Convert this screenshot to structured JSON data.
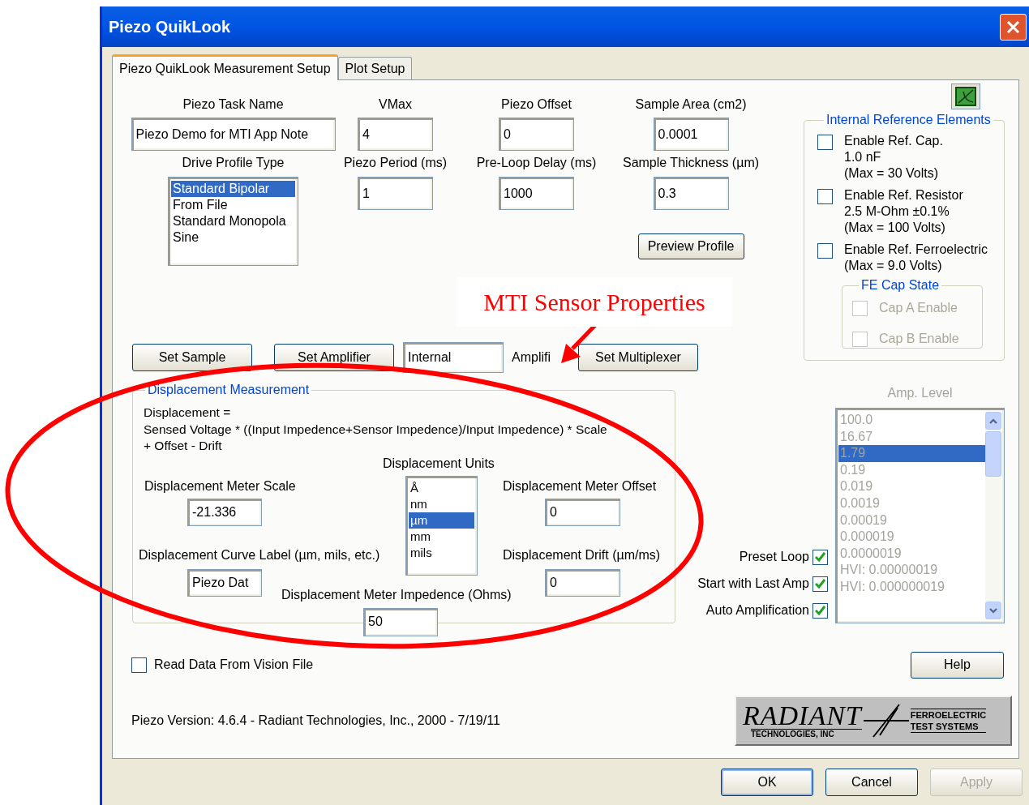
{
  "window": {
    "title": "Piezo QuikLook"
  },
  "tabs": [
    {
      "label": "Piezo QuikLook Measurement Setup",
      "selected": true
    },
    {
      "label": "Plot Setup",
      "selected": false
    }
  ],
  "task_name": {
    "label": "Piezo Task Name",
    "value": "Piezo Demo for MTI App Note"
  },
  "drive_profile": {
    "label": "Drive Profile Type",
    "options": [
      {
        "label": "Standard Bipolar",
        "selected": true
      },
      {
        "label": "From File",
        "selected": false
      },
      {
        "label": "Standard Monopola",
        "selected": false
      },
      {
        "label": "Sine",
        "selected": false
      }
    ]
  },
  "parameter_columns": [
    {
      "top": {
        "label": "VMax",
        "value": "4"
      },
      "bottom": {
        "label": "Piezo Period (ms)",
        "value": "1"
      }
    },
    {
      "top": {
        "label": "Piezo Offset",
        "value": "0"
      },
      "bottom": {
        "label": "Pre-Loop Delay (ms)",
        "value": "1000"
      }
    },
    {
      "top": {
        "label": "Sample Area (cm2)",
        "value": "0.0001"
      },
      "bottom": {
        "label": "Sample Thickness (µm)",
        "value": "0.3"
      }
    }
  ],
  "preview_button": "Preview Profile",
  "reference_elements": {
    "title": "Internal Reference Elements",
    "items": [
      {
        "label": "Enable Ref. Cap.\n1.0 nF\n(Max = 30 Volts)",
        "checked": false
      },
      {
        "label": "Enable Ref. Resistor\n2.5 M-Ohm ±0.1%\n(Max = 100 Volts)",
        "checked": false
      },
      {
        "label": "Enable Ref. Ferroelectric\n(Max = 9.0 Volts)",
        "checked": false
      }
    ],
    "fe_cap_state": {
      "title": "FE Cap State",
      "items": [
        {
          "label": "Cap A Enable",
          "checked": false,
          "disabled": true
        },
        {
          "label": "Cap B Enable",
          "checked": false,
          "disabled": true
        }
      ]
    }
  },
  "action_row": [
    {
      "kind": "button",
      "label": "Set Sample"
    },
    {
      "kind": "button",
      "label": "Set Amplifier"
    },
    {
      "kind": "field",
      "value": "Internal"
    },
    {
      "kind": "label",
      "label": "Amplifi"
    },
    {
      "kind": "button",
      "label": "Set Multiplexer"
    }
  ],
  "displacement": {
    "title": "Displacement Measurement",
    "formula": "Displacement =\nSensed Voltage * ((Input Impedence+Sensor Impedence)/Input Impedence) * Scale\n+ Offset - Drift",
    "scale": {
      "label": "Displacement Meter Scale",
      "value": "-21.336"
    },
    "curve_label": {
      "label": "Displacement Curve Label (µm, mils, etc.)",
      "value": "Piezo Dat"
    },
    "units": {
      "label": "Displacement Units",
      "options": [
        {
          "label": "Å",
          "selected": false
        },
        {
          "label": "nm",
          "selected": false
        },
        {
          "label": "µm",
          "selected": true
        },
        {
          "label": "mm",
          "selected": false
        },
        {
          "label": "mils",
          "selected": false
        }
      ]
    },
    "offset": {
      "label": "Displacement Meter Offset",
      "value": "0"
    },
    "drift": {
      "label": "Displacement Drift (µm/ms)",
      "value": "0"
    },
    "impedence": {
      "label": "Displacement Meter Impedence (Ohms)",
      "value": "50"
    }
  },
  "options": [
    {
      "label": "Preset Loop",
      "checked": true
    },
    {
      "label": "Start with Last Amp",
      "checked": true
    },
    {
      "label": "Auto Amplification",
      "checked": true
    }
  ],
  "amp_level": {
    "label": "Amp. Level",
    "options": [
      {
        "label": "100.0",
        "selected": false
      },
      {
        "label": "16.67",
        "selected": false
      },
      {
        "label": "1.79",
        "selected": true
      },
      {
        "label": "0.19",
        "selected": false
      },
      {
        "label": "0.019",
        "selected": false
      },
      {
        "label": "0.0019",
        "selected": false
      },
      {
        "label": "0.00019",
        "selected": false
      },
      {
        "label": "0.000019",
        "selected": false
      },
      {
        "label": "0.0000019",
        "selected": false
      },
      {
        "label": "HVI: 0.00000019",
        "selected": false
      },
      {
        "label": "HVI: 0.000000019",
        "selected": false
      }
    ]
  },
  "read_vision_file": {
    "label": "Read Data From Vision File",
    "checked": false
  },
  "help_button": "Help",
  "version": "Piezo Version: 4.6.4 - Radiant Technologies, Inc., 2000 - 7/19/11",
  "logo": {
    "name": "RADIANT",
    "subtitle": "TECHNOLOGIES, INC",
    "tagline": "FERROELECTRIC\nTEST SYSTEMS"
  },
  "dialog_buttons": [
    {
      "label": "OK",
      "disabled": false
    },
    {
      "label": "Cancel",
      "disabled": false
    },
    {
      "label": "Apply",
      "disabled": true
    }
  ],
  "annotation": {
    "callout": "MTI Sensor Properties"
  }
}
